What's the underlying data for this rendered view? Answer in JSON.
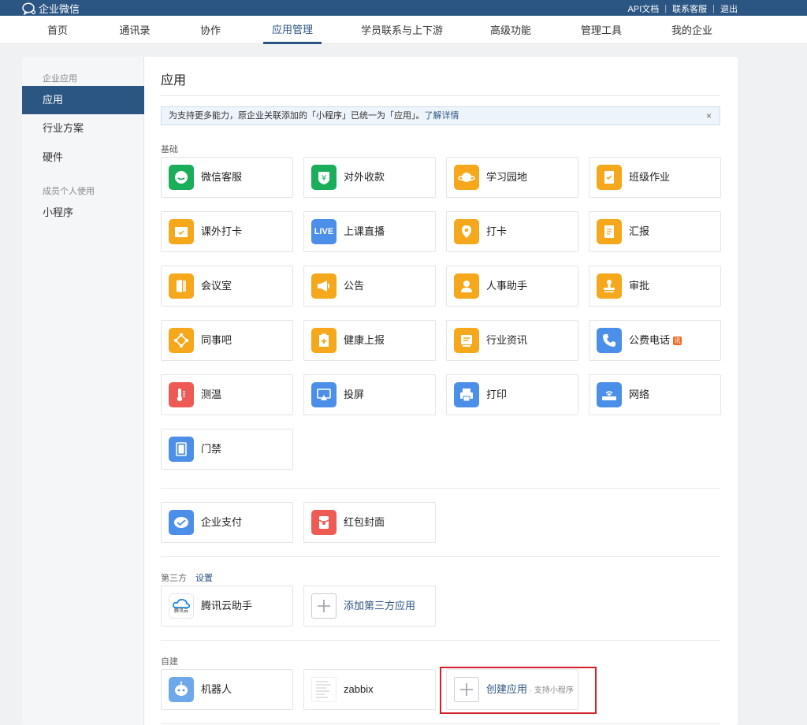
{
  "header": {
    "logo_text": "企业微信",
    "links": [
      "API文档",
      "联系客服",
      "退出"
    ]
  },
  "nav": {
    "items": [
      "首页",
      "通讯录",
      "协作",
      "应用管理",
      "学员联系与上下游",
      "高级功能",
      "管理工具",
      "我的企业"
    ],
    "active": "应用管理"
  },
  "sidebar": {
    "group1": "企业应用",
    "items": [
      "应用",
      "行业方案",
      "硬件"
    ],
    "group2": "成员个人使用",
    "items2": [
      "小程序"
    ]
  },
  "main": {
    "title": "应用",
    "notice": "为支持更多能力，原企业关联添加的「小程序」已统一为「应用」。",
    "notice_link": "了解详情",
    "notice_close": "×",
    "section_basic": "基础",
    "basic_apps": [
      {
        "label": "微信客服",
        "icon": "wechat-service-icon",
        "color": "#1aad5a"
      },
      {
        "label": "对外收款",
        "icon": "payment-icon",
        "color": "#1aad5a"
      },
      {
        "label": "学习园地",
        "icon": "planet-icon",
        "color": "#f5a81c"
      },
      {
        "label": "班级作业",
        "icon": "homework-icon",
        "color": "#f5a81c"
      },
      {
        "label": "课外打卡",
        "icon": "checkin-calendar-icon",
        "color": "#f5a81c"
      },
      {
        "label": "上课直播",
        "icon": "live-icon",
        "color": "#4c8fe8"
      },
      {
        "label": "打卡",
        "icon": "location-pin-icon",
        "color": "#f5a81c"
      },
      {
        "label": "汇报",
        "icon": "report-icon",
        "color": "#f5a81c"
      },
      {
        "label": "会议室",
        "icon": "meeting-room-icon",
        "color": "#f5a81c"
      },
      {
        "label": "公告",
        "icon": "megaphone-icon",
        "color": "#f5a81c"
      },
      {
        "label": "人事助手",
        "icon": "hr-person-icon",
        "color": "#f5a81c"
      },
      {
        "label": "审批",
        "icon": "stamp-icon",
        "color": "#f5a81c"
      },
      {
        "label": "同事吧",
        "icon": "colleague-network-icon",
        "color": "#f5a81c"
      },
      {
        "label": "健康上报",
        "icon": "health-clipboard-icon",
        "color": "#f5a81c"
      },
      {
        "label": "行业资讯",
        "icon": "news-icon",
        "color": "#f5a81c"
      },
      {
        "label": "公费电话",
        "icon": "phone-icon",
        "color": "#4c8fe8",
        "badge": "讯"
      },
      {
        "label": "测温",
        "icon": "thermometer-icon",
        "color": "#ee5a54"
      },
      {
        "label": "投屏",
        "icon": "screen-cast-icon",
        "color": "#4c8fe8"
      },
      {
        "label": "打印",
        "icon": "printer-icon",
        "color": "#4c8fe8"
      },
      {
        "label": "网络",
        "icon": "router-icon",
        "color": "#4c8fe8"
      },
      {
        "label": "门禁",
        "icon": "door-icon",
        "color": "#4c8fe8"
      }
    ],
    "pay_apps": [
      {
        "label": "企业支付",
        "icon": "enterprise-pay-icon",
        "color": "#4c8fe8"
      },
      {
        "label": "红包封面",
        "icon": "red-packet-icon",
        "color": "#ee5a54"
      }
    ],
    "section_third": "第三方",
    "third_settings": "设置",
    "third_apps": [
      {
        "label": "腾讯云助手",
        "icon": "tencent-cloud-icon"
      }
    ],
    "third_add": "添加第三方应用",
    "section_custom": "自建",
    "custom_apps": [
      {
        "label": "机器人",
        "icon": "robot-icon"
      },
      {
        "label": "zabbix",
        "icon": "document-thumbnail-icon"
      }
    ],
    "create_app": "创建应用",
    "create_app_sub": " · 支持小程序",
    "tencent_cloud_text": "腾讯云",
    "live_text": "LIVE"
  }
}
